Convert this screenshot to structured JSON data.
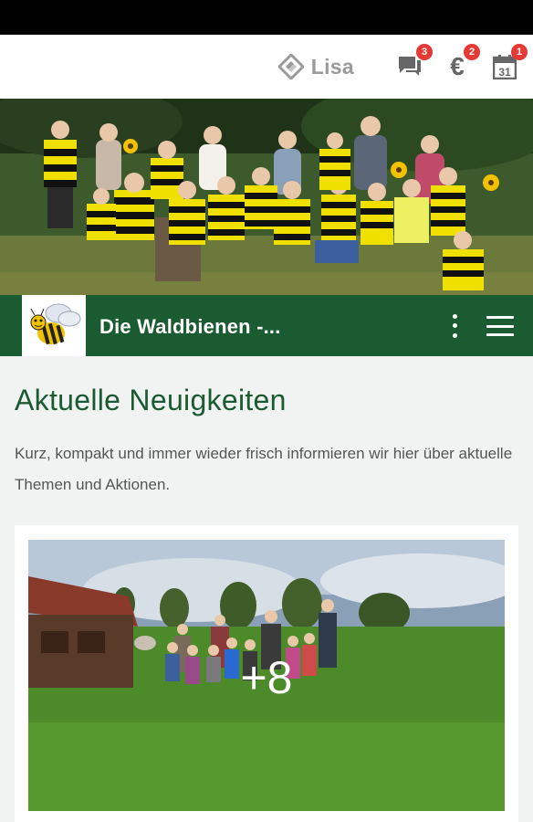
{
  "topbar": {
    "user_name": "Lisa",
    "messages_badge": "3",
    "payments_badge": "2",
    "calendar_badge": "1",
    "calendar_day": "31",
    "euro_symbol": "€"
  },
  "group": {
    "title": "Die Waldbienen -..."
  },
  "news": {
    "heading": "Aktuelle Neuigkeiten",
    "description": "Kurz, kompakt und immer wieder frisch informieren wir hier über aktuelle Themen und Aktionen."
  },
  "post": {
    "more_photos": "+8"
  },
  "colors": {
    "brand_green": "#1b5b32",
    "badge_red": "#e53935",
    "icon_grey": "#666666"
  }
}
